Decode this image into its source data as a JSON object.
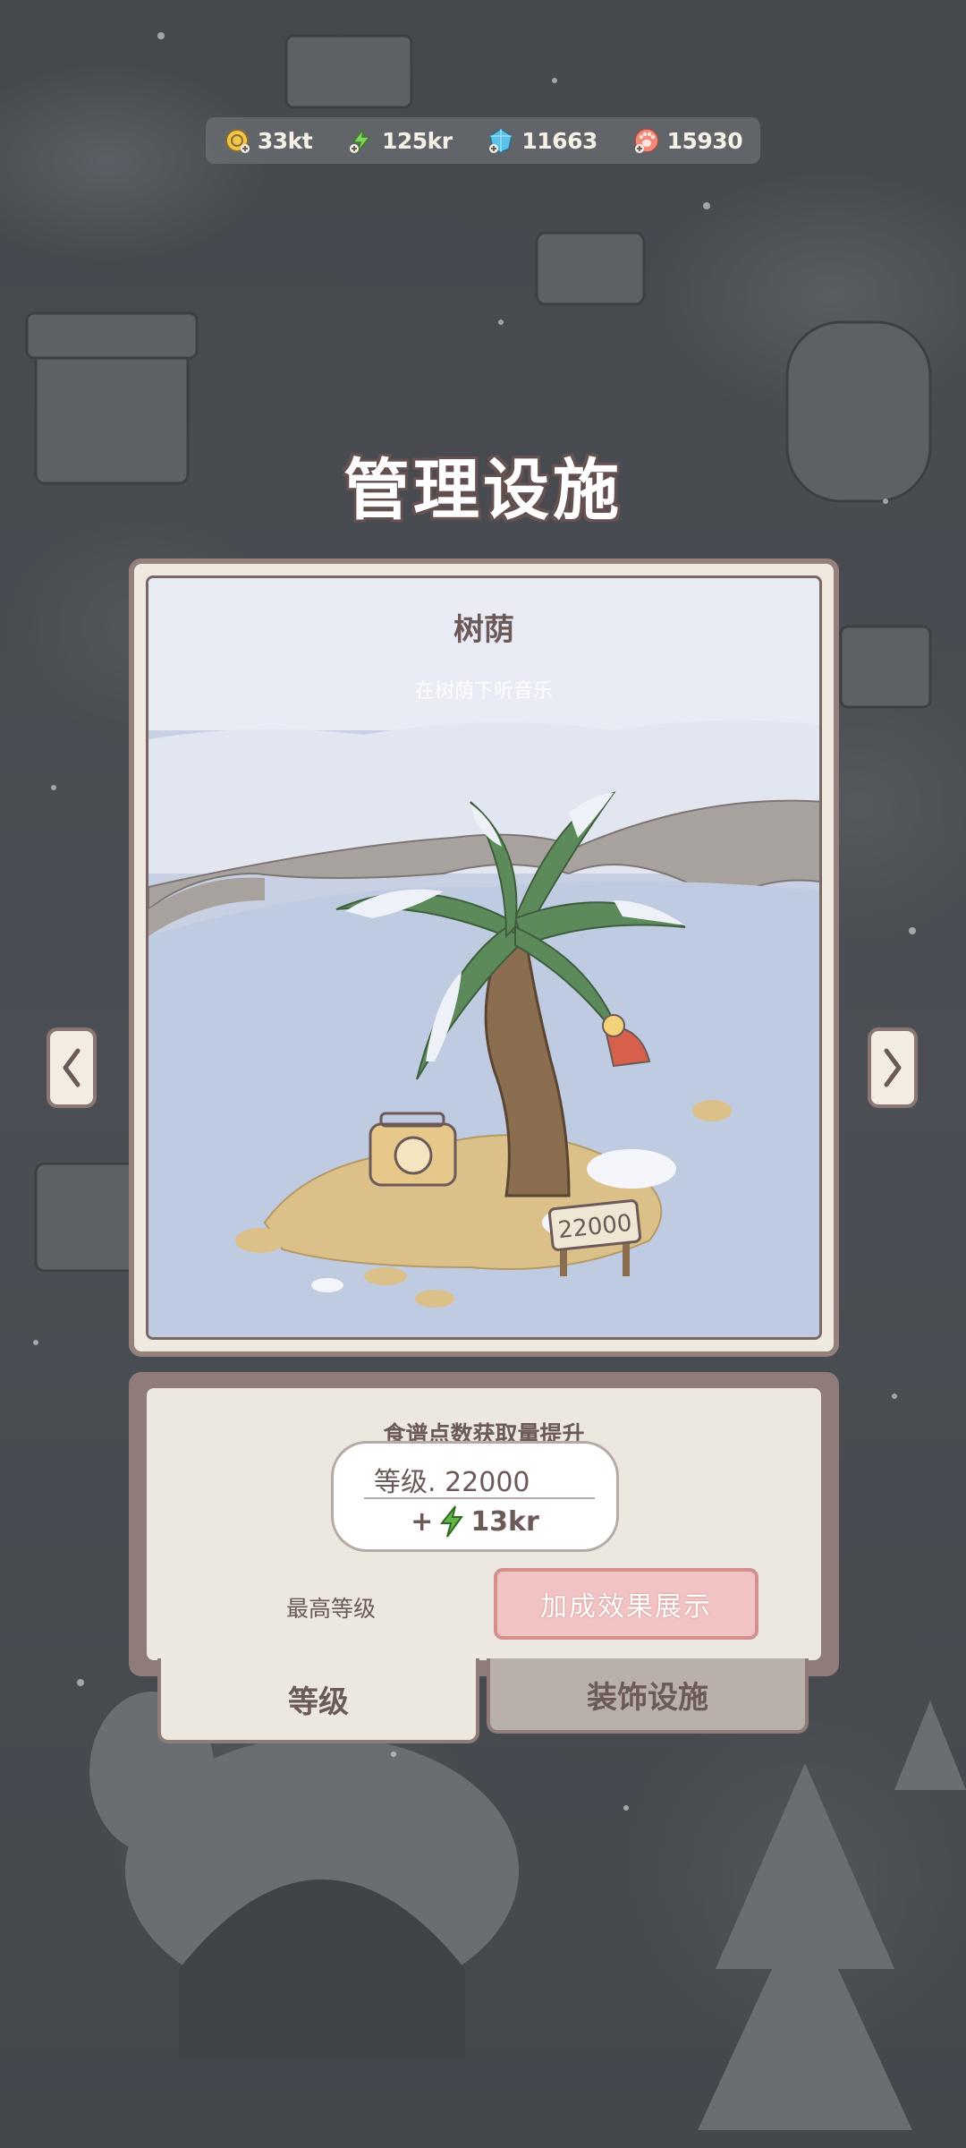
{
  "resources": [
    {
      "icon": "coin-icon",
      "value": "33kt"
    },
    {
      "icon": "lightning-icon",
      "value": "125kr"
    },
    {
      "icon": "crystal-icon",
      "value": "11663"
    },
    {
      "icon": "paw-icon",
      "value": "15930"
    }
  ],
  "page_title": "管理设施",
  "facility": {
    "name": "树荫",
    "description": "在树荫下听音乐",
    "sign_value": "22000"
  },
  "effect": {
    "title": "食谱点数获取量提升",
    "level_label": "等级. 22000",
    "bonus_prefix": "+",
    "bonus_value": "13kr",
    "max_level_label": "最高等级",
    "show_button": "加成效果展示"
  },
  "tabs": [
    {
      "label": "等级",
      "active": true
    },
    {
      "label": "装饰设施",
      "active": false
    }
  ],
  "colors": {
    "accent_pink": "#f1c4c3",
    "frame_brown": "#8f7c78",
    "text_brown": "#6b5a57",
    "lightning_green": "#63b34a"
  }
}
